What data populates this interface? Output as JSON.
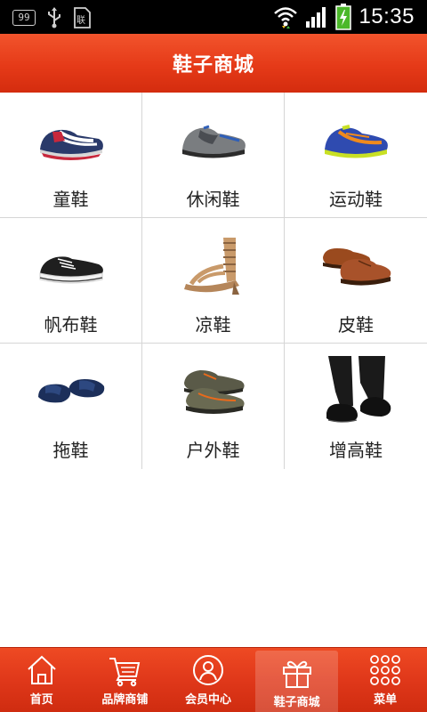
{
  "status_bar": {
    "badge": "99",
    "time": "15:35",
    "icons": [
      "notification-badge-icon",
      "usb-icon",
      "sim-icon",
      "wifi-icon",
      "signal-icon",
      "battery-charging-icon"
    ]
  },
  "header": {
    "title": "鞋子商城"
  },
  "categories": [
    {
      "label": "童鞋",
      "icon": "kids-shoe-image"
    },
    {
      "label": "休闲鞋",
      "icon": "casual-shoe-image"
    },
    {
      "label": "运动鞋",
      "icon": "sports-shoe-image"
    },
    {
      "label": "帆布鞋",
      "icon": "canvas-shoe-image"
    },
    {
      "label": "凉鞋",
      "icon": "sandal-image"
    },
    {
      "label": "皮鞋",
      "icon": "leather-shoe-image"
    },
    {
      "label": "拖鞋",
      "icon": "slipper-image"
    },
    {
      "label": "户外鞋",
      "icon": "outdoor-shoe-image"
    },
    {
      "label": "增高鞋",
      "icon": "elevator-shoe-image"
    }
  ],
  "bottom_nav": {
    "items": [
      {
        "label": "首页",
        "icon": "home-icon",
        "active": false
      },
      {
        "label": "品牌商铺",
        "icon": "cart-icon",
        "active": false
      },
      {
        "label": "会员中心",
        "icon": "user-icon",
        "active": false
      },
      {
        "label": "鞋子商城",
        "icon": "gift-icon",
        "active": true
      },
      {
        "label": "菜单",
        "icon": "menu-grid-icon",
        "active": false
      }
    ]
  },
  "colors": {
    "brand_red": "#e53a18",
    "divider": "#d6d6d6",
    "text": "#222222"
  }
}
